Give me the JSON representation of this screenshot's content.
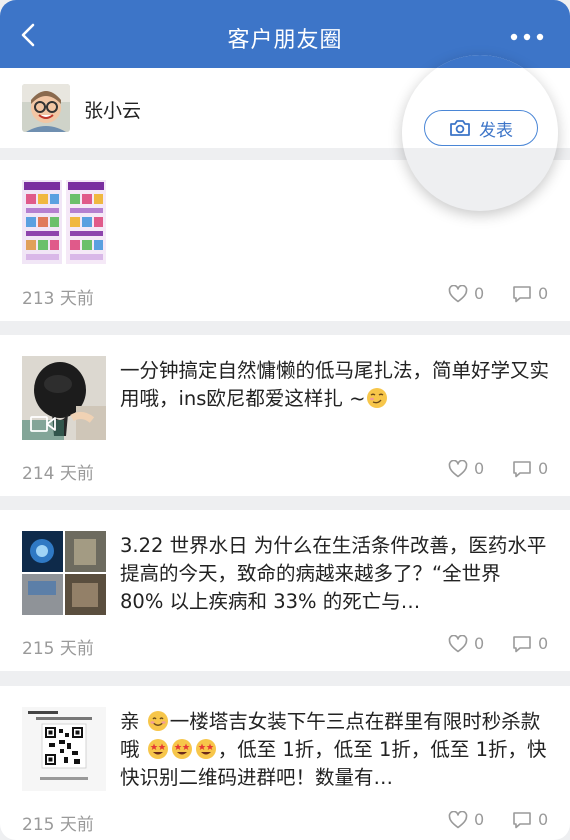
{
  "header": {
    "title": "客户朋友圈",
    "back_icon": "chevron-left-icon",
    "more_icon": "more-dots-icon",
    "background": "#3d75c8"
  },
  "profile": {
    "name": "张小云",
    "publish_label": "发表",
    "publish_icon": "camera-icon"
  },
  "posts": [
    {
      "text": "",
      "time": "213 天前",
      "likes": "0",
      "comments": "0",
      "thumb": "poster-grid"
    },
    {
      "text_before": "一分钟搞定自然慵懒的低马尾扎法，简单好学又实用哦，ins欧尼都爱这样扎 ~",
      "emoji": "smirk-emoji",
      "time": "214 天前",
      "likes": "0",
      "comments": "0",
      "thumb": "hair-video",
      "thumb_icon": "video-icon"
    },
    {
      "text": "3.22 世界水日 为什么在生活条件改善，医药水平提高的今天，致命的病越来越多了？“全世界 80% 以上疾病和 33% 的死亡与…",
      "time": "215 天前",
      "likes": "0",
      "comments": "0",
      "thumb": "photo-grid"
    },
    {
      "text_a": "亲 ",
      "text_b": "一楼塔吉女装下午三点在群里有限时秒杀款哦 ",
      "text_c": "，低至 1折，低至 1折，低至 1折，快快识别二维码进群吧！数量有…",
      "time": "215 天前",
      "likes": "0",
      "comments": "0",
      "thumb": "qr-poster"
    }
  ],
  "colors": {
    "accent": "#3d75c8",
    "muted": "#9a9a9a"
  }
}
